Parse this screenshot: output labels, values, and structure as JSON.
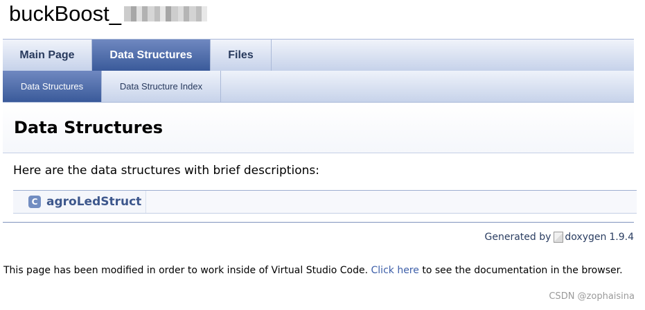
{
  "project": {
    "title": "buckBoost_"
  },
  "main_tabs": [
    {
      "label": "Main Page",
      "active": false
    },
    {
      "label": "Data Structures",
      "active": true
    },
    {
      "label": "Files",
      "active": false
    }
  ],
  "sub_tabs": [
    {
      "label": "Data Structures",
      "active": true
    },
    {
      "label": "Data Structure Index",
      "active": false
    }
  ],
  "header": {
    "title": "Data Structures"
  },
  "content": {
    "description": "Here are the data structures with brief descriptions:",
    "structures": [
      {
        "icon_letter": "C",
        "name": "agroLedStruct"
      }
    ]
  },
  "footer": {
    "generated_by": "Generated by",
    "logo_alt": "doxygen",
    "version": "1.9.4"
  },
  "notice": {
    "text_before": "This page has been modified in order to work inside of Virtual Studio Code.",
    "link": "Click here",
    "text_after": "to see the documentation in the browser."
  },
  "watermark": {
    "text": "CSDN @zophaisina"
  },
  "colors": {
    "accent": "#3a5a9a",
    "link": "#3d578c",
    "icon_bg": "#728dc1"
  },
  "icons": {
    "class_icon": "class-c-icon",
    "broken_image": "broken-image-icon",
    "redacted": "pixelated-redaction"
  }
}
